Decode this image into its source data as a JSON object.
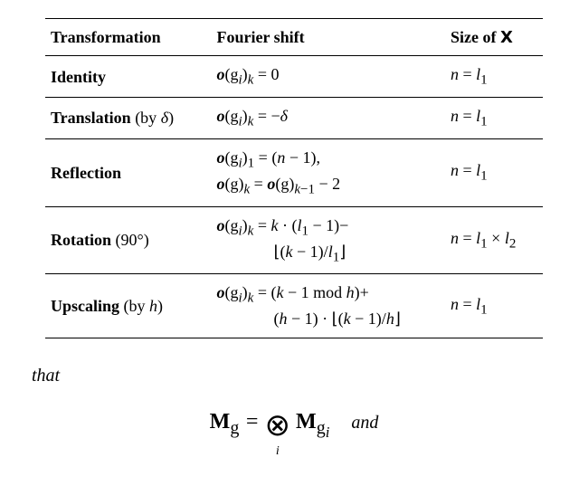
{
  "table": {
    "headers": {
      "transformation": "Transformation",
      "fourier_shift": "Fourier shift",
      "size": "Size of 𝗫"
    },
    "rows": [
      {
        "name_html": "Identity",
        "shift_html": "<b><i>o</i></b>(g<sub><i>i</i></sub>)<sub><i>k</i></sub> = 0",
        "size_html": "<i>n</i> = <i>l</i><sub>1</sub>"
      },
      {
        "name_html": "Translation <span style='font-weight:normal'>(by <i>δ</i>)</span>",
        "shift_html": "<b><i>o</i></b>(g<sub><i>i</i></sub>)<sub><i>k</i></sub> = −<i>δ</i>",
        "size_html": "<i>n</i> = <i>l</i><sub>1</sub>"
      },
      {
        "name_html": "Reflection",
        "shift_html": "<b><i>o</i></b>(g<sub><i>i</i></sub>)<sub>1</sub> = (<i>n</i> − 1),<br><b><i>o</i></b>(g)<sub><i>k</i></sub> = <b><i>o</i></b>(g)<sub><i>k</i>−1</sub> − 2",
        "size_html": "<i>n</i> = <i>l</i><sub>1</sub>"
      },
      {
        "name_html": "Rotation <span style='font-weight:normal'>(90°)</span>",
        "shift_html": "<b><i>o</i></b>(g<sub><i>i</i></sub>)<sub><i>k</i></sub> = <i>k</i> · (<i>l</i><sub>1</sub> − 1)−<br>&nbsp;&nbsp;&nbsp;&nbsp;&nbsp;&nbsp;&nbsp;&nbsp;&nbsp;&nbsp;&nbsp;&nbsp;&nbsp;&nbsp;⌊(<i>k</i> − 1)/<i>l</i><sub>1</sub>⌋",
        "size_html": "<i>n</i> = <i>l</i><sub>1</sub> × <i>l</i><sub>2</sub>"
      },
      {
        "name_html": "Upscaling <span style='font-weight:normal'>(by <i>h</i>)</span>",
        "shift_html": "<b><i>o</i></b>(g<sub><i>i</i></sub>)<sub><i>k</i></sub> = (<i>k</i> − 1 mod <i>h</i>)+<br>&nbsp;&nbsp;&nbsp;&nbsp;&nbsp;&nbsp;&nbsp;&nbsp;&nbsp;&nbsp;&nbsp;&nbsp;&nbsp;&nbsp;(<i>h</i> − 1) · ⌊(<i>k</i> − 1)/<i>h</i>⌋",
        "size_html": "<i>n</i> = <i>l</i><sub>1</sub>"
      }
    ]
  },
  "body": {
    "that": "that",
    "equation_html": "<b><span class='rm'>M</span></b><sub><span class='rm'>g</span></sub> = <span class='bigotimes'>⊗<span class='sub'>i</span></span> <b><span class='rm'>M</span></b><sub><span class='rm'>g</span><i><sub>i</sub></i></sub><span class='and'>and</span>"
  }
}
